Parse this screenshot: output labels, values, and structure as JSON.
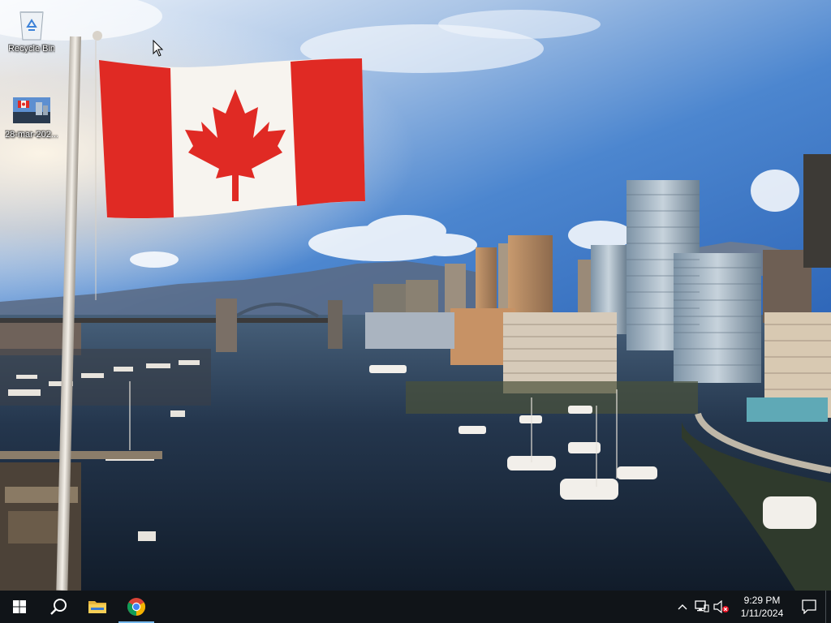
{
  "desktop": {
    "icons": [
      {
        "name": "recycle-bin",
        "label": "Recycle Bin"
      },
      {
        "name": "image-file",
        "label": "28-mar-202..."
      }
    ]
  },
  "taskbar": {
    "pinned": [
      {
        "icon": "windows-start-icon",
        "active": false
      },
      {
        "icon": "search-icon",
        "active": false
      },
      {
        "icon": "file-explorer-icon",
        "active": false
      },
      {
        "icon": "chrome-icon",
        "active": true
      }
    ],
    "tray": {
      "icons": [
        "chevron-up-icon",
        "network-icon",
        "volume-muted-icon"
      ],
      "time": "9:29 PM",
      "date": "1/11/2024"
    }
  },
  "colors": {
    "taskbar_bg": "#101418",
    "active_indicator": "#76b9ed",
    "flag_red": "#e02a24"
  }
}
